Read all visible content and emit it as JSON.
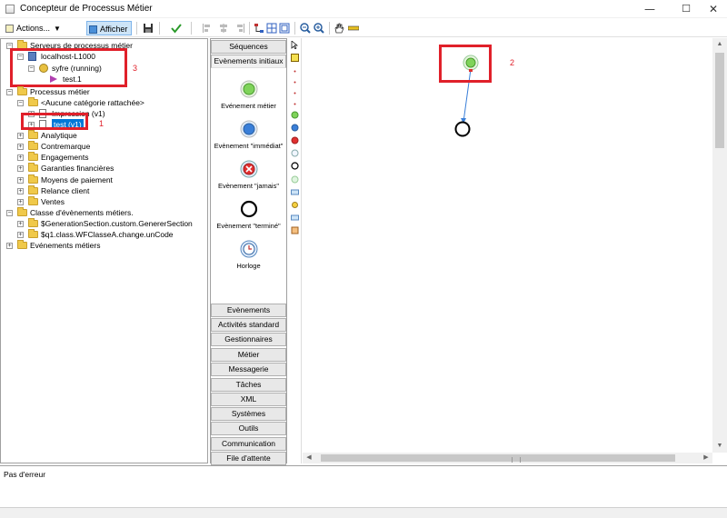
{
  "window": {
    "title": "Concepteur de Processus Métier",
    "minimize": "—",
    "maximize": "☐",
    "close": "✕"
  },
  "toolbar": {
    "actions_label": "Actions...",
    "afficher_label": "Afficher"
  },
  "tree": {
    "servers_root": "Serveurs de processus métier",
    "server": "localhost-L1000",
    "engine": "syfre (running)",
    "instance": "test.1",
    "processes_root": "Processus métier",
    "no_category": "<Aucune catégorie rattachée>",
    "impression": "Impression (v1)",
    "test_process": "test (v1)",
    "categories": [
      "Analytique",
      "Contremarque",
      "Engagements",
      "Garanties financières",
      "Moyens de paiement",
      "Relance client",
      "Ventes"
    ],
    "event_classes_root": "Classe d'évènements métiers.",
    "event_class_1": "$GenerationSection.custom.GenererSection",
    "event_class_2": "$q1.class.WFClasseA.change.unCode",
    "events_root": "Evénements métiers"
  },
  "annotations": {
    "a1": "1",
    "a2": "2",
    "a3": "3"
  },
  "palette": {
    "top_tabs": [
      "Séquences",
      "Evènements initiaux"
    ],
    "items": [
      "Evénement métier",
      "Evènement \"immédiat\"",
      "Evènement \"jamais\"",
      "Evènement \"terminé\"",
      "Horloge"
    ],
    "bottom_tabs": [
      "Evènements",
      "Activités standard",
      "Gestionnaires",
      "Métier",
      "Messagerie",
      "Tâches",
      "XML",
      "Systèmes",
      "Outils",
      "Communication",
      "File d'attente"
    ]
  },
  "status": {
    "message": "Pas d'erreur"
  },
  "colors": {
    "accent": "#0078d7",
    "annotation": "#e0202a",
    "start_event": "#7fd35a",
    "connector": "#3a7fd8"
  }
}
